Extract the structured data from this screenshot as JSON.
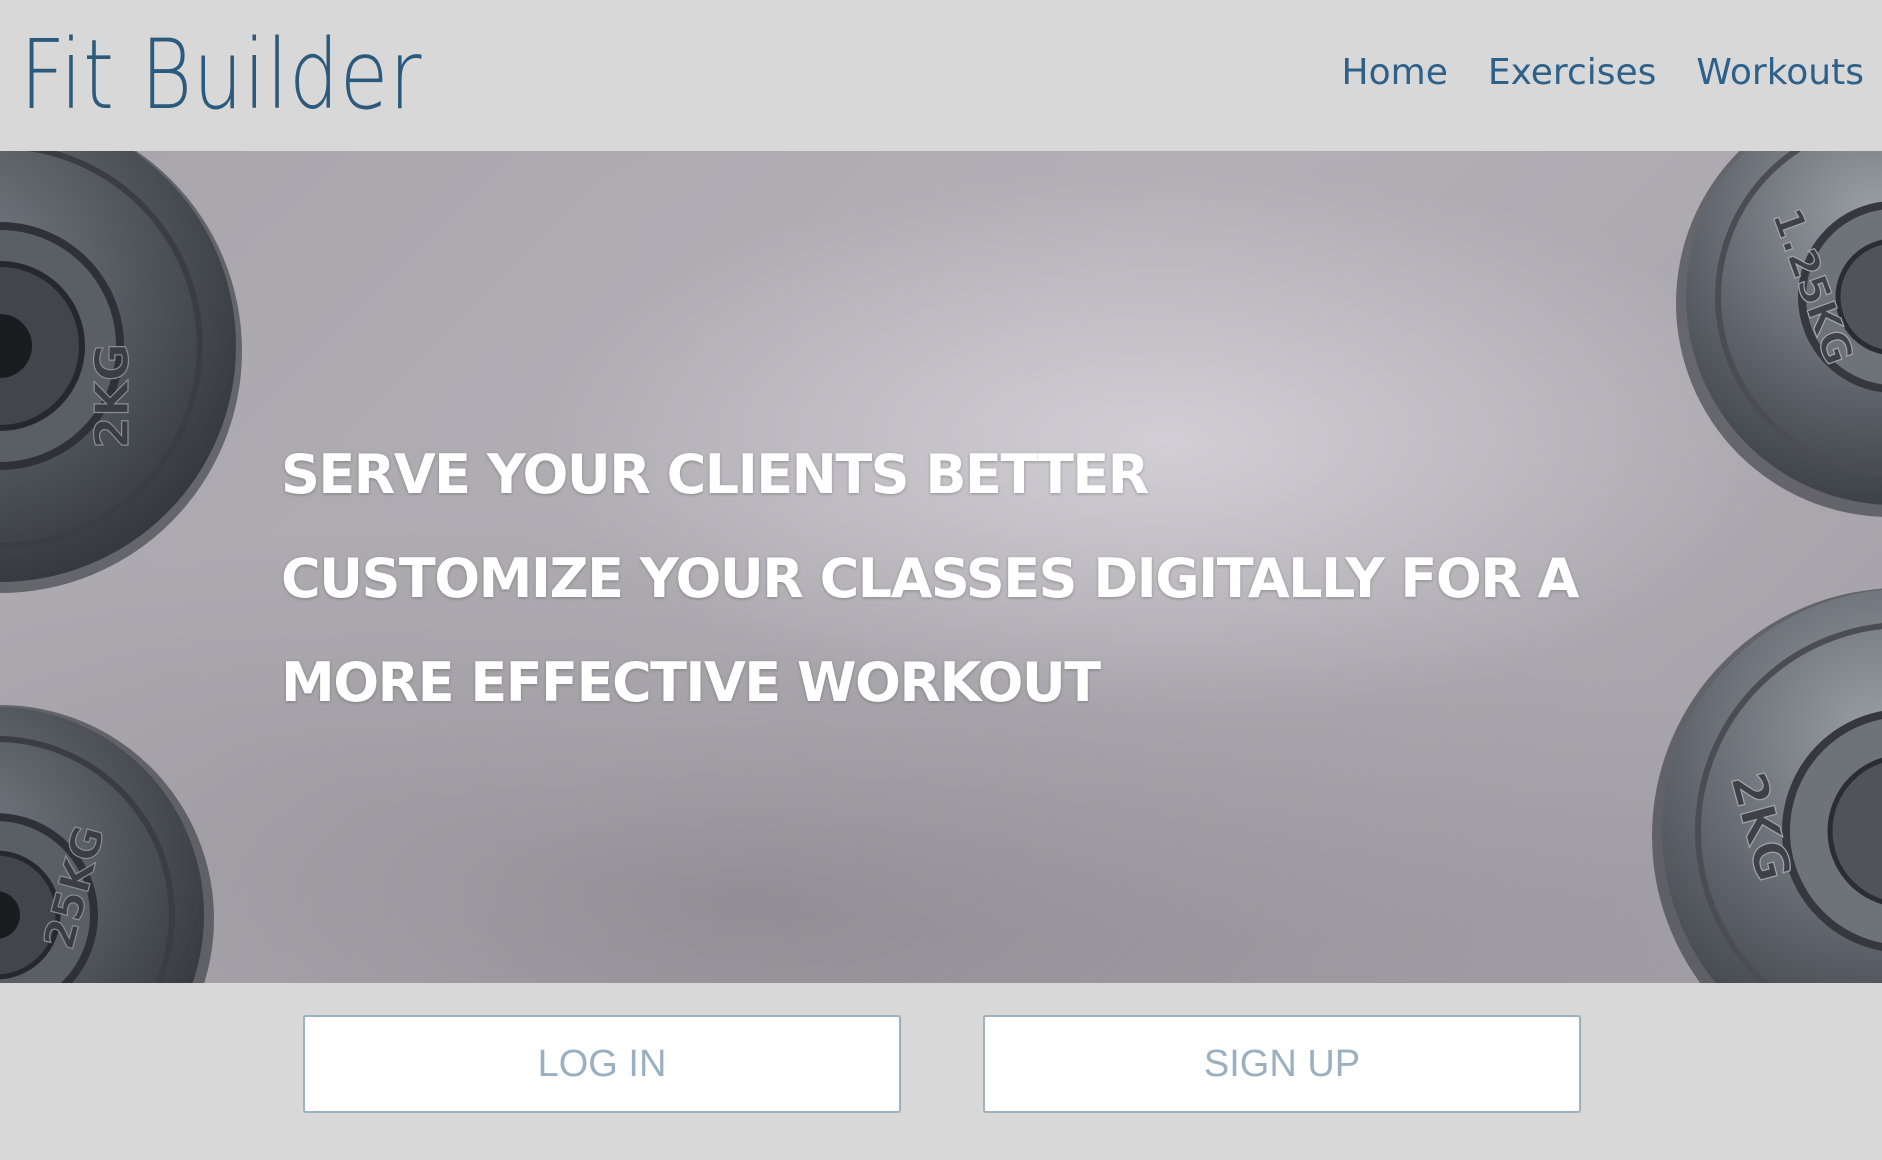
{
  "header": {
    "logo": "Fit Builder",
    "nav": [
      "Home",
      "Exercises",
      "Workouts"
    ]
  },
  "hero": {
    "lines": [
      "SERVE YOUR CLIENTS BETTER",
      "CUSTOMIZE YOUR CLASSES DIGITALLY FOR A",
      "MORE EFFECTIVE WORKOUT"
    ],
    "plate_labels": {
      "left_top": "2KG",
      "left_bottom": "25KG",
      "right_top": "1.25KG",
      "right_bottom": "2KG"
    }
  },
  "actions": {
    "login_label": "LOG IN",
    "signup_label": "SIGN UP"
  },
  "colors": {
    "background": "#d8d8d8",
    "logo": "#2c5a7c",
    "nav": "#2e6189",
    "button_text": "#9aafc0",
    "button_border": "#9fb0bd"
  }
}
